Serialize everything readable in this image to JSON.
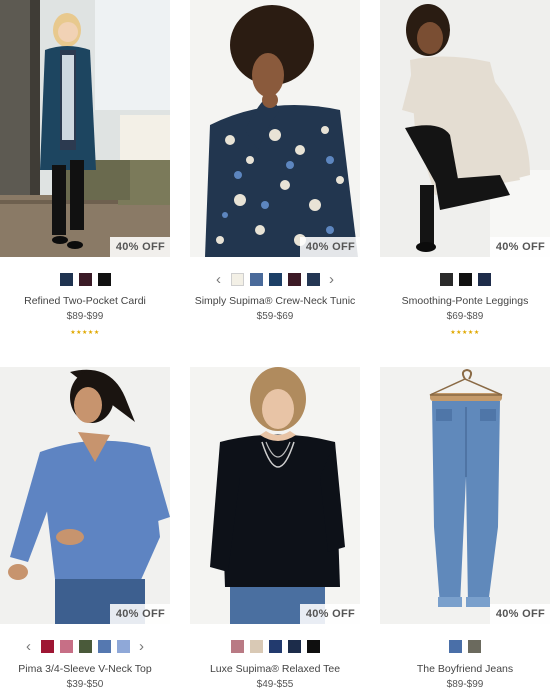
{
  "products": [
    {
      "name": "Refined Two-Pocket Cardi",
      "price": "$89-$99",
      "badge": "40% OFF",
      "stars": "★★★★★",
      "swatches": [
        "#1f3350",
        "#3a1a26",
        "#111111"
      ]
    },
    {
      "name": "Simply Supima® Crew-Neck Tunic",
      "price": "$59-$69",
      "badge": "40% OFF",
      "stars": "",
      "prev_arrow": "‹",
      "next_arrow": "›",
      "swatches": [
        "#f3f0e6",
        "#4a6a9a",
        "#1d3f66",
        "#3c1a26",
        "#243754"
      ]
    },
    {
      "name": "Smoothing-Ponte Leggings",
      "price": "$69-$89",
      "badge": "40% OFF",
      "stars": "★★★★★",
      "swatches": [
        "#2a2a2a",
        "#111111",
        "#1e2c4a"
      ]
    },
    {
      "name": "Pima 3/4-Sleeve V-Neck Top",
      "price": "$39-$50",
      "badge": "40% OFF",
      "stars": "",
      "prev_arrow": "‹",
      "next_arrow": "›",
      "swatches": [
        "#9e1633",
        "#c76f86",
        "#4a5a3a",
        "#5578b0",
        "#8fa8d8"
      ]
    },
    {
      "name": "Luxe Supima® Relaxed Tee",
      "price": "$49-$55",
      "badge": "40% OFF",
      "stars": "",
      "swatches": [
        "#b97a84",
        "#d9c9b5",
        "#223a6e",
        "#1c2c4a",
        "#0f0f0f"
      ]
    },
    {
      "name": "The Boyfriend Jeans",
      "price": "$89-$99",
      "badge": "40% OFF",
      "stars": "",
      "swatches": [
        "#4a6fa8",
        "#6b6a5e"
      ]
    }
  ]
}
